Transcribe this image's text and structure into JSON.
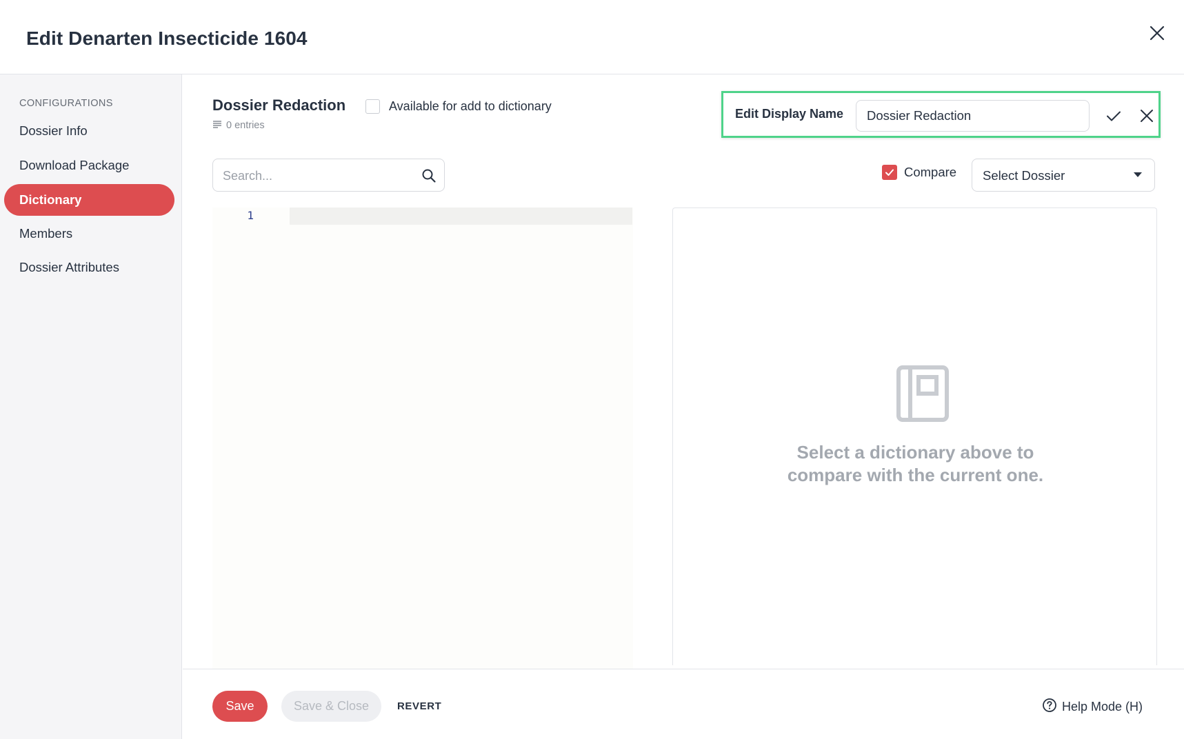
{
  "dialog": {
    "title": "Edit Denarten Insecticide 1604"
  },
  "sidebar": {
    "heading": "CONFIGURATIONS",
    "items": [
      {
        "label": "Dossier Info",
        "active": false
      },
      {
        "label": "Download Package",
        "active": false
      },
      {
        "label": "Dictionary",
        "active": true
      },
      {
        "label": "Members",
        "active": false
      },
      {
        "label": "Dossier Attributes",
        "active": false
      }
    ]
  },
  "dictionary": {
    "name": "Dossier Redaction",
    "entries": "0 entries",
    "available_label": "Available for add to dictionary",
    "available_checked": false
  },
  "edit_display_name": {
    "label": "Edit Display Name",
    "value": "Dossier Redaction"
  },
  "search": {
    "placeholder": "Search..."
  },
  "compare": {
    "label": "Compare",
    "checked": true,
    "select_value": "Select Dossier"
  },
  "editor": {
    "line_numbers": [
      "1"
    ]
  },
  "compare_panel": {
    "empty_line1": "Select a dictionary above to",
    "empty_line2": "compare with the current one."
  },
  "footer": {
    "save_label": "Save",
    "save_close_label": "Save & Close",
    "revert_label": "REVERT",
    "help_label": "Help Mode (H)"
  },
  "colors": {
    "accent": "#dd4d50",
    "highlight_border": "#4fd38a",
    "text": "#283241",
    "muted": "#a3a8af"
  }
}
